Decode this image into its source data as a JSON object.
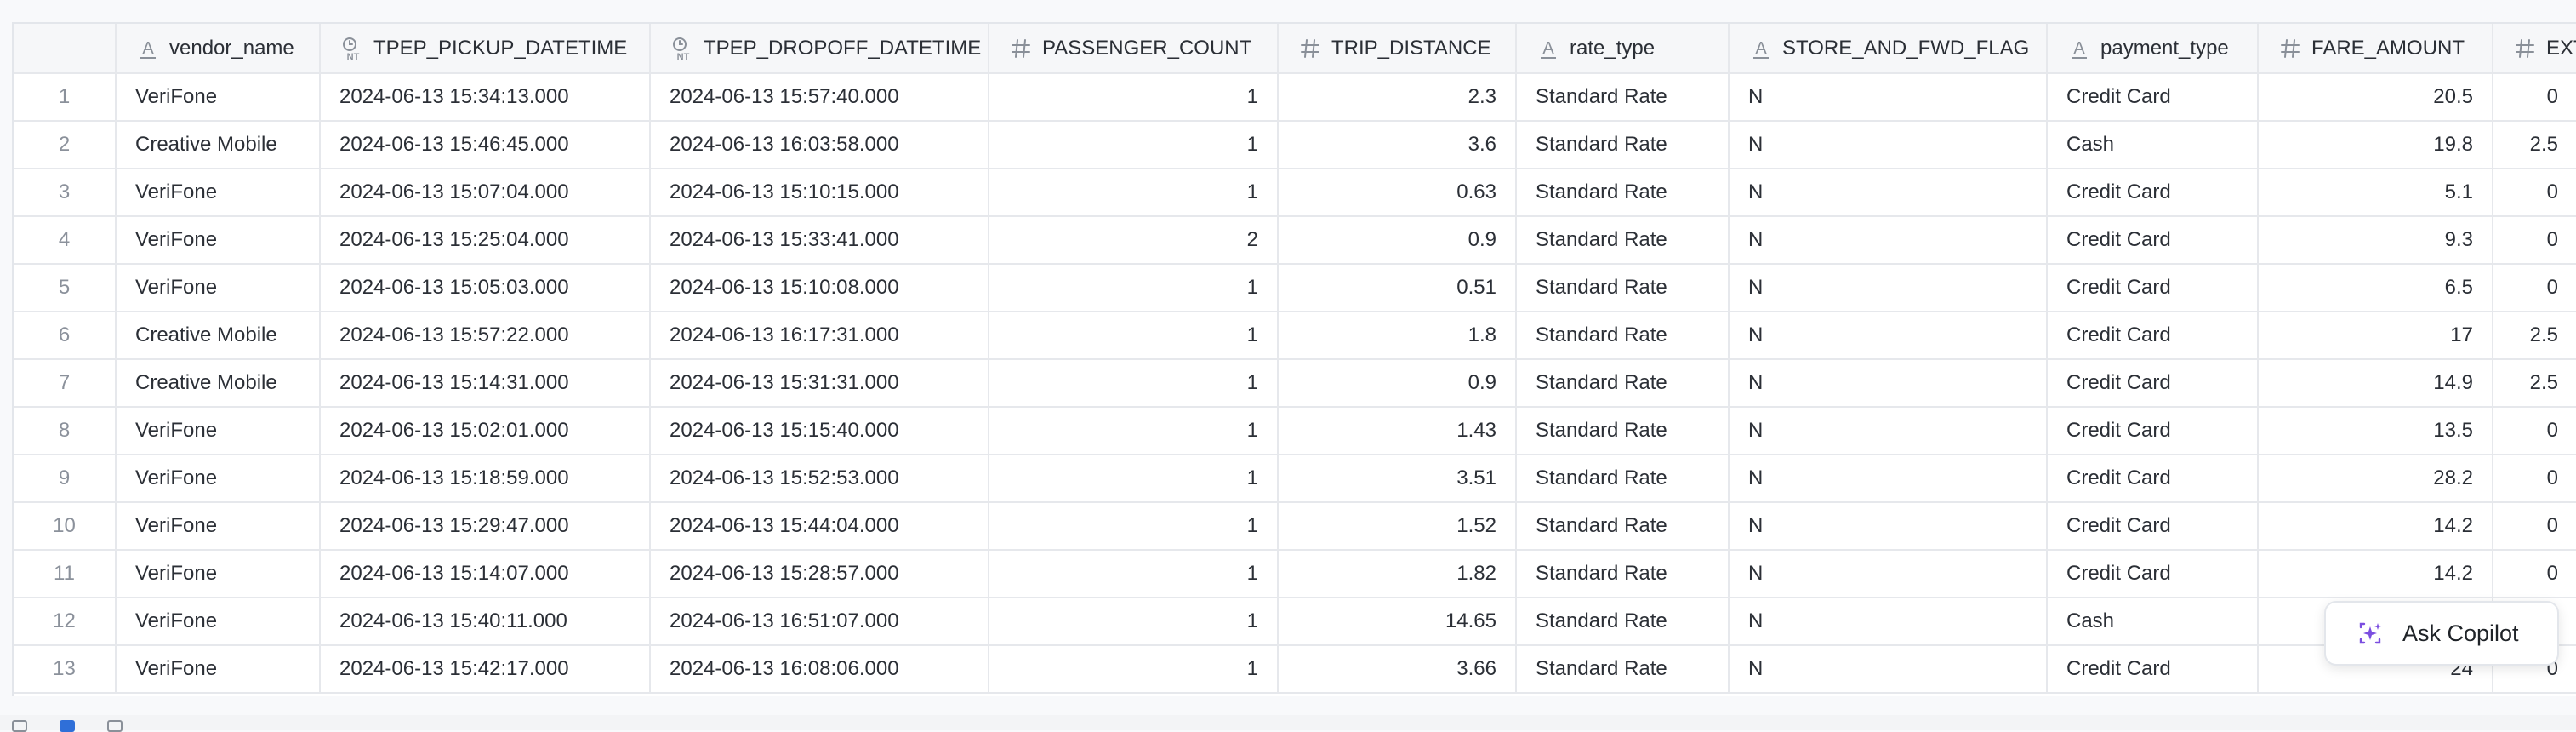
{
  "columns": [
    {
      "key": "rownum",
      "label": "",
      "type": "rownum"
    },
    {
      "key": "vendor_name",
      "label": "vendor_name",
      "type": "text"
    },
    {
      "key": "tpep_pickup_datetime",
      "label": "TPEP_PICKUP_DATETIME",
      "type": "datetime"
    },
    {
      "key": "tpep_dropoff_datetime",
      "label": "TPEP_DROPOFF_DATETIME",
      "type": "datetime"
    },
    {
      "key": "passenger_count",
      "label": "PASSENGER_COUNT",
      "type": "number"
    },
    {
      "key": "trip_distance",
      "label": "TRIP_DISTANCE",
      "type": "number"
    },
    {
      "key": "rate_type",
      "label": "rate_type",
      "type": "text"
    },
    {
      "key": "store_and_fwd_flag",
      "label": "STORE_AND_FWD_FLAG",
      "type": "text"
    },
    {
      "key": "payment_type",
      "label": "payment_type",
      "type": "text"
    },
    {
      "key": "fare_amount",
      "label": "FARE_AMOUNT",
      "type": "number"
    },
    {
      "key": "extra",
      "label": "EXTRA",
      "type": "number"
    }
  ],
  "rows": [
    [
      "1",
      "VeriFone",
      "2024-06-13 15:34:13.000",
      "2024-06-13 15:57:40.000",
      "1",
      "2.3",
      "Standard Rate",
      "N",
      "Credit Card",
      "20.5",
      "0"
    ],
    [
      "2",
      "Creative Mobile",
      "2024-06-13 15:46:45.000",
      "2024-06-13 16:03:58.000",
      "1",
      "3.6",
      "Standard Rate",
      "N",
      "Cash",
      "19.8",
      "2.5"
    ],
    [
      "3",
      "VeriFone",
      "2024-06-13 15:07:04.000",
      "2024-06-13 15:10:15.000",
      "1",
      "0.63",
      "Standard Rate",
      "N",
      "Credit Card",
      "5.1",
      "0"
    ],
    [
      "4",
      "VeriFone",
      "2024-06-13 15:25:04.000",
      "2024-06-13 15:33:41.000",
      "2",
      "0.9",
      "Standard Rate",
      "N",
      "Credit Card",
      "9.3",
      "0"
    ],
    [
      "5",
      "VeriFone",
      "2024-06-13 15:05:03.000",
      "2024-06-13 15:10:08.000",
      "1",
      "0.51",
      "Standard Rate",
      "N",
      "Credit Card",
      "6.5",
      "0"
    ],
    [
      "6",
      "Creative Mobile",
      "2024-06-13 15:57:22.000",
      "2024-06-13 16:17:31.000",
      "1",
      "1.8",
      "Standard Rate",
      "N",
      "Credit Card",
      "17",
      "2.5"
    ],
    [
      "7",
      "Creative Mobile",
      "2024-06-13 15:14:31.000",
      "2024-06-13 15:31:31.000",
      "1",
      "0.9",
      "Standard Rate",
      "N",
      "Credit Card",
      "14.9",
      "2.5"
    ],
    [
      "8",
      "VeriFone",
      "2024-06-13 15:02:01.000",
      "2024-06-13 15:15:40.000",
      "1",
      "1.43",
      "Standard Rate",
      "N",
      "Credit Card",
      "13.5",
      "0"
    ],
    [
      "9",
      "VeriFone",
      "2024-06-13 15:18:59.000",
      "2024-06-13 15:52:53.000",
      "1",
      "3.51",
      "Standard Rate",
      "N",
      "Credit Card",
      "28.2",
      "0"
    ],
    [
      "10",
      "VeriFone",
      "2024-06-13 15:29:47.000",
      "2024-06-13 15:44:04.000",
      "1",
      "1.52",
      "Standard Rate",
      "N",
      "Credit Card",
      "14.2",
      "0"
    ],
    [
      "11",
      "VeriFone",
      "2024-06-13 15:14:07.000",
      "2024-06-13 15:28:57.000",
      "1",
      "1.82",
      "Standard Rate",
      "N",
      "Credit Card",
      "14.2",
      "0"
    ],
    [
      "12",
      "VeriFone",
      "2024-06-13 15:40:11.000",
      "2024-06-13 16:51:07.000",
      "1",
      "14.65",
      "Standard Rate",
      "N",
      "Cash",
      "",
      ""
    ],
    [
      "13",
      "VeriFone",
      "2024-06-13 15:42:17.000",
      "2024-06-13 16:08:06.000",
      "1",
      "3.66",
      "Standard Rate",
      "N",
      "Credit Card",
      "24",
      "0"
    ]
  ],
  "copilot": {
    "label": "Ask Copilot"
  },
  "colors": {
    "accent": "#2f6fd8",
    "copilot_icon": "#7b4ee0"
  }
}
